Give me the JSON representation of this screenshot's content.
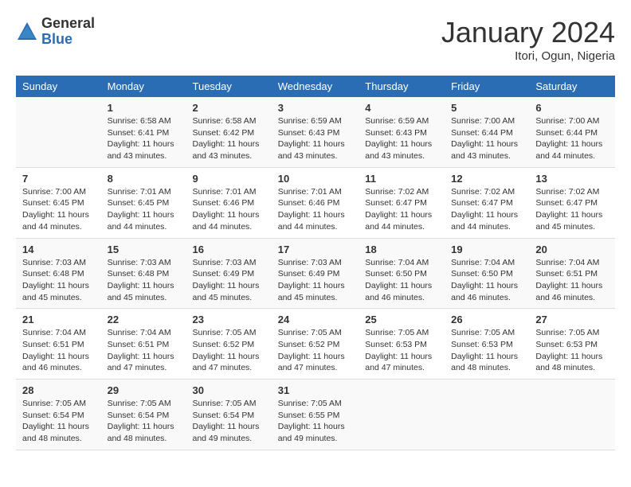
{
  "header": {
    "logo_general": "General",
    "logo_blue": "Blue",
    "title": "January 2024",
    "location": "Itori, Ogun, Nigeria"
  },
  "days_of_week": [
    "Sunday",
    "Monday",
    "Tuesday",
    "Wednesday",
    "Thursday",
    "Friday",
    "Saturday"
  ],
  "weeks": [
    [
      {
        "day": "",
        "sunrise": "",
        "sunset": "",
        "daylight": ""
      },
      {
        "day": "1",
        "sunrise": "6:58 AM",
        "sunset": "6:41 PM",
        "daylight": "11 hours and 43 minutes."
      },
      {
        "day": "2",
        "sunrise": "6:58 AM",
        "sunset": "6:42 PM",
        "daylight": "11 hours and 43 minutes."
      },
      {
        "day": "3",
        "sunrise": "6:59 AM",
        "sunset": "6:43 PM",
        "daylight": "11 hours and 43 minutes."
      },
      {
        "day": "4",
        "sunrise": "6:59 AM",
        "sunset": "6:43 PM",
        "daylight": "11 hours and 43 minutes."
      },
      {
        "day": "5",
        "sunrise": "7:00 AM",
        "sunset": "6:44 PM",
        "daylight": "11 hours and 43 minutes."
      },
      {
        "day": "6",
        "sunrise": "7:00 AM",
        "sunset": "6:44 PM",
        "daylight": "11 hours and 44 minutes."
      }
    ],
    [
      {
        "day": "7",
        "sunrise": "7:00 AM",
        "sunset": "6:45 PM",
        "daylight": "11 hours and 44 minutes."
      },
      {
        "day": "8",
        "sunrise": "7:01 AM",
        "sunset": "6:45 PM",
        "daylight": "11 hours and 44 minutes."
      },
      {
        "day": "9",
        "sunrise": "7:01 AM",
        "sunset": "6:46 PM",
        "daylight": "11 hours and 44 minutes."
      },
      {
        "day": "10",
        "sunrise": "7:01 AM",
        "sunset": "6:46 PM",
        "daylight": "11 hours and 44 minutes."
      },
      {
        "day": "11",
        "sunrise": "7:02 AM",
        "sunset": "6:47 PM",
        "daylight": "11 hours and 44 minutes."
      },
      {
        "day": "12",
        "sunrise": "7:02 AM",
        "sunset": "6:47 PM",
        "daylight": "11 hours and 44 minutes."
      },
      {
        "day": "13",
        "sunrise": "7:02 AM",
        "sunset": "6:47 PM",
        "daylight": "11 hours and 45 minutes."
      }
    ],
    [
      {
        "day": "14",
        "sunrise": "7:03 AM",
        "sunset": "6:48 PM",
        "daylight": "11 hours and 45 minutes."
      },
      {
        "day": "15",
        "sunrise": "7:03 AM",
        "sunset": "6:48 PM",
        "daylight": "11 hours and 45 minutes."
      },
      {
        "day": "16",
        "sunrise": "7:03 AM",
        "sunset": "6:49 PM",
        "daylight": "11 hours and 45 minutes."
      },
      {
        "day": "17",
        "sunrise": "7:03 AM",
        "sunset": "6:49 PM",
        "daylight": "11 hours and 45 minutes."
      },
      {
        "day": "18",
        "sunrise": "7:04 AM",
        "sunset": "6:50 PM",
        "daylight": "11 hours and 46 minutes."
      },
      {
        "day": "19",
        "sunrise": "7:04 AM",
        "sunset": "6:50 PM",
        "daylight": "11 hours and 46 minutes."
      },
      {
        "day": "20",
        "sunrise": "7:04 AM",
        "sunset": "6:51 PM",
        "daylight": "11 hours and 46 minutes."
      }
    ],
    [
      {
        "day": "21",
        "sunrise": "7:04 AM",
        "sunset": "6:51 PM",
        "daylight": "11 hours and 46 minutes."
      },
      {
        "day": "22",
        "sunrise": "7:04 AM",
        "sunset": "6:51 PM",
        "daylight": "11 hours and 47 minutes."
      },
      {
        "day": "23",
        "sunrise": "7:05 AM",
        "sunset": "6:52 PM",
        "daylight": "11 hours and 47 minutes."
      },
      {
        "day": "24",
        "sunrise": "7:05 AM",
        "sunset": "6:52 PM",
        "daylight": "11 hours and 47 minutes."
      },
      {
        "day": "25",
        "sunrise": "7:05 AM",
        "sunset": "6:53 PM",
        "daylight": "11 hours and 47 minutes."
      },
      {
        "day": "26",
        "sunrise": "7:05 AM",
        "sunset": "6:53 PM",
        "daylight": "11 hours and 48 minutes."
      },
      {
        "day": "27",
        "sunrise": "7:05 AM",
        "sunset": "6:53 PM",
        "daylight": "11 hours and 48 minutes."
      }
    ],
    [
      {
        "day": "28",
        "sunrise": "7:05 AM",
        "sunset": "6:54 PM",
        "daylight": "11 hours and 48 minutes."
      },
      {
        "day": "29",
        "sunrise": "7:05 AM",
        "sunset": "6:54 PM",
        "daylight": "11 hours and 48 minutes."
      },
      {
        "day": "30",
        "sunrise": "7:05 AM",
        "sunset": "6:54 PM",
        "daylight": "11 hours and 49 minutes."
      },
      {
        "day": "31",
        "sunrise": "7:05 AM",
        "sunset": "6:55 PM",
        "daylight": "11 hours and 49 minutes."
      },
      {
        "day": "",
        "sunrise": "",
        "sunset": "",
        "daylight": ""
      },
      {
        "day": "",
        "sunrise": "",
        "sunset": "",
        "daylight": ""
      },
      {
        "day": "",
        "sunrise": "",
        "sunset": "",
        "daylight": ""
      }
    ]
  ]
}
